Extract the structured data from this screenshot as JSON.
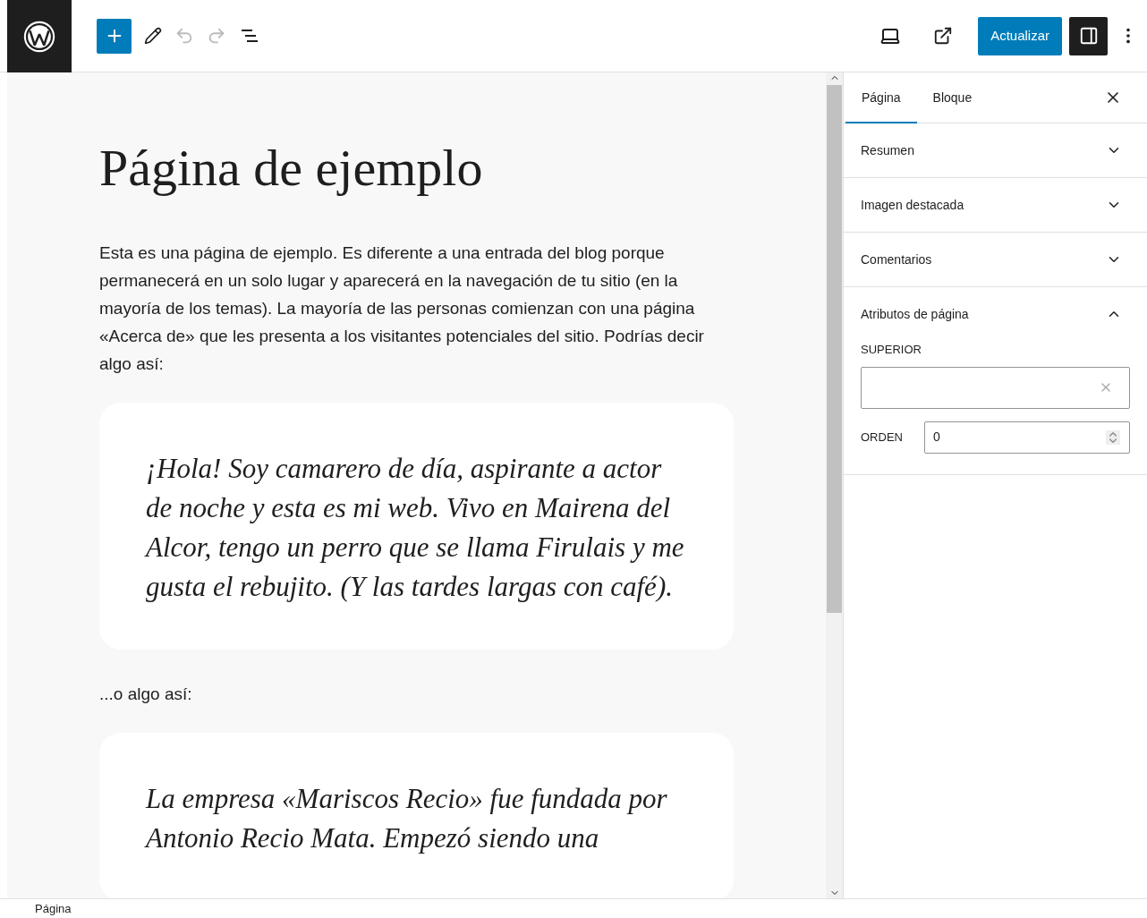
{
  "toolbar": {
    "update_button": "Actualizar",
    "settings_toggle_on": true
  },
  "editor": {
    "title": "Página de ejemplo",
    "blocks": [
      {
        "kind": "paragraph",
        "text": "Esta es una página de ejemplo. Es diferente a una entrada del blog porque permanecerá en un solo lugar y aparecerá en la navegación de tu sitio (en la mayoría de los temas). La mayoría de las personas comienzan con una página «Acerca de» que les presenta a los visitantes potenciales del sitio. Podrías decir algo así:"
      },
      {
        "kind": "quote",
        "text": "¡Hola! Soy camarero de día, aspirante a actor de noche y esta es mi web. Vivo en Mairena del Alcor, tengo un perro que se llama Firulais y me gusta el rebujito. (Y las tardes largas con café)."
      },
      {
        "kind": "paragraph",
        "text": "...o algo así:"
      },
      {
        "kind": "quote",
        "text": "La empresa «Mariscos Recio» fue fundada por Antonio Recio Mata. Empezó siendo una"
      }
    ]
  },
  "sidebar": {
    "tabs": [
      {
        "label": "Página",
        "selected": true
      },
      {
        "label": "Bloque",
        "selected": false
      }
    ],
    "panels": [
      {
        "title": "Resumen",
        "expanded": false
      },
      {
        "title": "Imagen destacada",
        "expanded": false
      },
      {
        "title": "Comentarios",
        "expanded": false
      },
      {
        "title": "Atributos de página",
        "expanded": true,
        "parent_label": "SUPERIOR",
        "order_label": "ORDEN",
        "order_value": "0"
      }
    ]
  },
  "status_bar": {
    "breadcrumb": "Página"
  }
}
